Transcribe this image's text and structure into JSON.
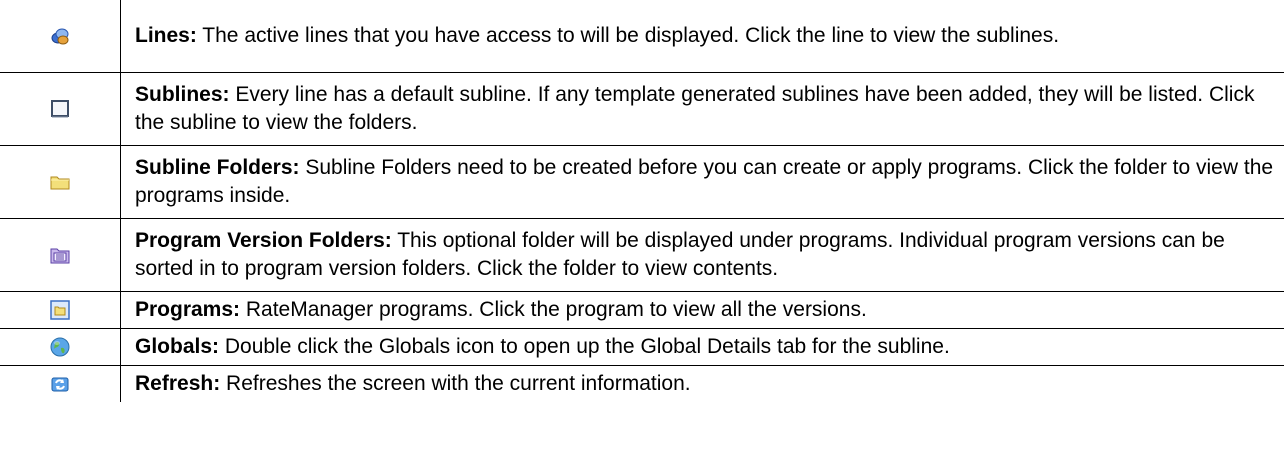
{
  "rows": [
    {
      "icon": "lines-icon",
      "term": "Lines:",
      "description": " The active lines that you have access to will be displayed. Click the line to view the sublines."
    },
    {
      "icon": "sublines-icon",
      "term": "Sublines:",
      "description": " Every line has a default subline. If any template generated sublines have been added, they will be listed. Click the subline to view the folders."
    },
    {
      "icon": "subline-folder-icon",
      "term": "Subline Folders:",
      "description": " Subline Folders need to be created before you can create or apply programs. Click the folder to view the programs inside."
    },
    {
      "icon": "program-version-folder-icon",
      "term": "Program Version Folders:",
      "description": " This optional folder will be displayed under programs. Individual program versions can be sorted in to program version folders. Click the folder to view contents."
    },
    {
      "icon": "programs-icon",
      "term": "Programs:",
      "description": " RateManager programs. Click the program to view all the versions."
    },
    {
      "icon": "globals-icon",
      "term": "Globals:",
      "description": " Double click the Globals icon to open up the Global Details tab for the subline."
    },
    {
      "icon": "refresh-icon",
      "term": "Refresh:",
      "description": " Refreshes the screen with the current information."
    }
  ]
}
